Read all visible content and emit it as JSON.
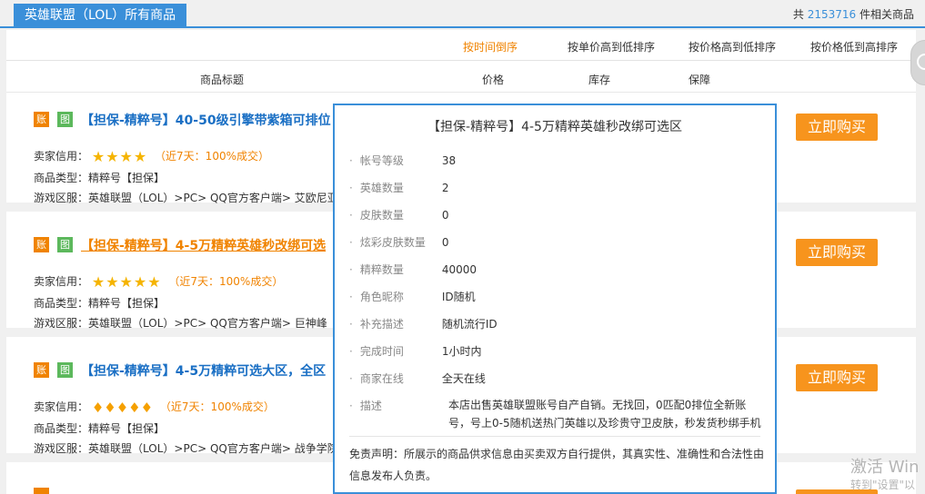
{
  "header": {
    "category_tab": "英雄联盟（LOL）所有商品",
    "total_prefix": "共",
    "total_count": "2153716",
    "total_suffix": "件相关商品"
  },
  "sort_options": [
    "按时间倒序",
    "按单价高到低排序",
    "按价格高到低排序",
    "按价格低到高排序"
  ],
  "active_sort": "按时间倒序",
  "columns": [
    "商品标题",
    "价格",
    "库存",
    "保障"
  ],
  "listings": [
    {
      "tag_account": "账",
      "tag_image": "图",
      "title": "【担保-精粹号】40-50级引擎带紫箱可排位",
      "credit_label": "卖家信用：",
      "rating_icon": "star-icon",
      "rating_count": 4,
      "recent": "（近7天：100%成交）",
      "type_label": "商品类型：",
      "type_value": "精粹号【担保】",
      "server_label": "游戏区服：",
      "server_value": "英雄联盟（LOL）>PC> QQ官方客户端> 艾欧尼亚",
      "buy_label": "立即购买"
    },
    {
      "tag_account": "账",
      "tag_image": "图",
      "title": "【担保-精粹号】4-5万精粹英雄秒改绑可选",
      "credit_label": "卖家信用：",
      "rating_icon": "star-icon",
      "rating_count": 5,
      "recent": "（近7天：100%成交）",
      "type_label": "商品类型：",
      "type_value": "精粹号【担保】",
      "server_label": "游戏区服：",
      "server_value": "英雄联盟（LOL）>PC> QQ官方客户端> 巨神峰",
      "buy_label": "立即购买"
    },
    {
      "tag_account": "账",
      "tag_image": "图",
      "title": "【担保-精粹号】4-5万精粹可选大区，全区",
      "credit_label": "卖家信用：",
      "rating_icon": "diamond-icon",
      "rating_count": 5,
      "recent": "（近7天：100%成交）",
      "type_label": "商品类型：",
      "type_value": "精粹号【担保】",
      "server_label": "游戏区服：",
      "server_value": "英雄联盟（LOL）>PC> QQ官方客户端> 战争学院",
      "buy_label": "立即购买"
    }
  ],
  "popup": {
    "title": "【担保-精粹号】4-5万精粹英雄秒改绑可选区",
    "rows": [
      {
        "key": "帐号等级",
        "value": "38"
      },
      {
        "key": "英雄数量",
        "value": "2"
      },
      {
        "key": "皮肤数量",
        "value": "0"
      },
      {
        "key": "炫彩皮肤数量",
        "value": "0"
      },
      {
        "key": "精粹数量",
        "value": "40000"
      },
      {
        "key": "角色昵称",
        "value": "ID随机"
      },
      {
        "key": "补充描述",
        "value": "随机流行ID"
      },
      {
        "key": "完成时间",
        "value": "1小时内"
      },
      {
        "key": "商家在线",
        "value": "全天在线"
      }
    ],
    "desc_key": "描述",
    "desc_value": "本店出售英雄联盟账号自产自销。无找回，0匹配0排位全新账号，号上0-5随机送热门英雄以及珍贵守卫皮肤，秒发货秒绑手机",
    "disclaimer": "免责声明：所展示的商品供求信息由买卖双方自行提供，其真实性、准确性和合法性由信息发布人负责。"
  },
  "watermark": {
    "line1": "激活 Win",
    "line2": "转到\"设置\"以"
  },
  "colors": {
    "accent_blue": "#3a8fd9",
    "orange": "#f08300",
    "buy_button": "#f7941d",
    "tag_green": "#5cb85c"
  }
}
